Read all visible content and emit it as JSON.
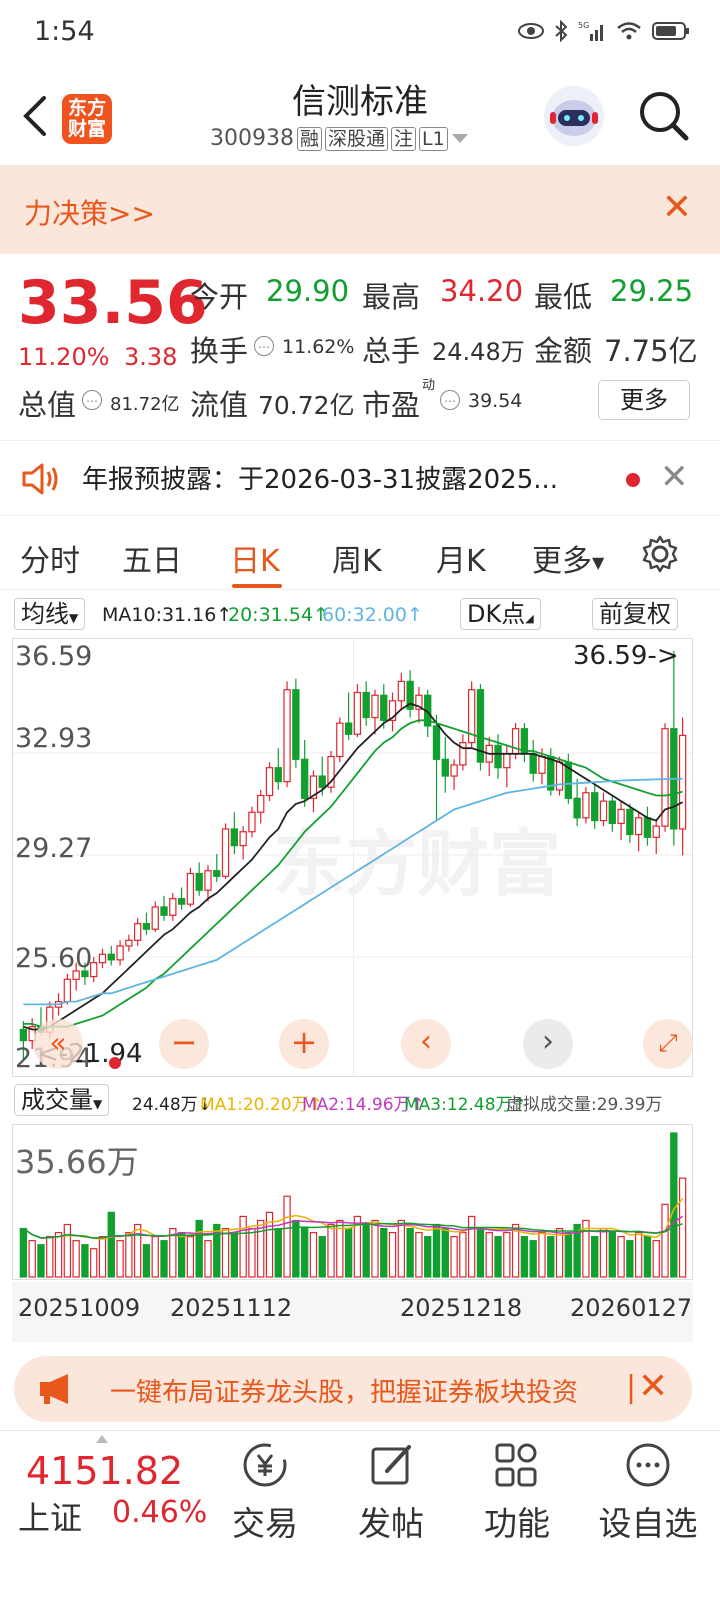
{
  "status": {
    "time": "1:54"
  },
  "header": {
    "logo_top": "东方",
    "logo_bottom": "财富",
    "title": "信测标准",
    "code": "300938",
    "tags": [
      "融",
      "深股通",
      "注",
      "L1"
    ]
  },
  "banner": {
    "text": "力决策>>"
  },
  "quote": {
    "price": "33.56",
    "change_pct": "11.20%",
    "change": "3.38",
    "open_label": "今开",
    "open": "29.90",
    "high_label": "最高",
    "high": "34.20",
    "low_label": "最低",
    "low": "29.25",
    "turnover_label": "换手",
    "turnover": "11.62%",
    "volume_label": "总手",
    "volume": "24.48万",
    "amount_label": "金额",
    "amount": "7.75亿",
    "mcap_label": "总值",
    "mcap": "81.72亿",
    "float_label": "流值",
    "float_cap": "70.72亿",
    "pe_label": "市盈",
    "pe_sup": "动",
    "pe": "39.54",
    "more": "更多"
  },
  "notice": {
    "text": "年报预披露：于2026-03-31披露2025..."
  },
  "tabs": [
    "分时",
    "五日",
    "日K",
    "周K",
    "月K",
    "更多"
  ],
  "ma": {
    "selector": "均线",
    "ma10": "MA10:31.16↑",
    "ma20": "20:31.54↑",
    "ma60": "60:32.00↑",
    "dk": "DK点",
    "adjust": "前复权"
  },
  "kchart": {
    "y_labels": [
      "36.59",
      "32.93",
      "29.27",
      "25.60",
      "21.94"
    ],
    "max_marker": "36.59->",
    "min_marker": "<-21.94"
  },
  "vol": {
    "selector": "成交量",
    "current": "24.48万↓",
    "ma1": "MA1:20.20万↑",
    "ma2": "MA2:14.96万↑",
    "ma3": "MA3:12.48万↑",
    "virtual": "虚拟成交量:29.39万",
    "max_label": "35.66万"
  },
  "dates": [
    "20251009",
    "20251112",
    "20251218",
    "20260127"
  ],
  "ad": {
    "text": "一键布局证券龙头股，把握证券板块投资"
  },
  "bottom": {
    "index_value": "4151.82",
    "index_name": "上证",
    "index_chg": "0.46%",
    "items": [
      "交易",
      "发帖",
      "功能",
      "设自选"
    ]
  },
  "colors": {
    "up": "#e0262f",
    "down": "#11a030",
    "accent": "#e8571b",
    "ma10": "#222222",
    "ma20": "#11a030",
    "ma60": "#5fb4e0"
  },
  "chart_data": {
    "type": "candlestick",
    "ylim": [
      21.94,
      36.59
    ],
    "candles": [
      [
        23.0,
        23.3,
        21.9,
        22.6
      ],
      [
        22.6,
        23.4,
        22.3,
        23.1
      ],
      [
        23.1,
        23.8,
        22.8,
        22.9
      ],
      [
        22.9,
        24.0,
        22.7,
        23.8
      ],
      [
        23.8,
        24.3,
        23.5,
        24.0
      ],
      [
        24.0,
        25.0,
        23.9,
        24.8
      ],
      [
        24.8,
        25.4,
        24.4,
        25.1
      ],
      [
        25.1,
        25.4,
        24.6,
        24.9
      ],
      [
        24.9,
        25.6,
        24.7,
        25.4
      ],
      [
        25.4,
        25.9,
        25.2,
        25.7
      ],
      [
        25.7,
        26.0,
        25.3,
        25.5
      ],
      [
        25.5,
        26.2,
        25.3,
        26.0
      ],
      [
        26.0,
        26.4,
        25.8,
        26.2
      ],
      [
        26.2,
        27.0,
        26.0,
        26.8
      ],
      [
        26.8,
        27.2,
        26.4,
        26.6
      ],
      [
        26.6,
        27.6,
        26.5,
        27.4
      ],
      [
        27.4,
        27.8,
        26.9,
        27.1
      ],
      [
        27.1,
        27.9,
        26.9,
        27.7
      ],
      [
        27.7,
        28.1,
        27.3,
        27.5
      ],
      [
        27.5,
        28.8,
        27.4,
        28.6
      ],
      [
        28.6,
        29.0,
        27.8,
        28.0
      ],
      [
        28.0,
        28.9,
        27.6,
        28.7
      ],
      [
        28.7,
        29.3,
        28.3,
        28.5
      ],
      [
        28.5,
        30.4,
        28.4,
        30.2
      ],
      [
        30.2,
        30.8,
        29.3,
        29.6
      ],
      [
        29.6,
        30.3,
        29.1,
        30.1
      ],
      [
        30.1,
        31.0,
        29.9,
        30.8
      ],
      [
        30.8,
        31.6,
        30.4,
        31.4
      ],
      [
        31.4,
        32.6,
        31.2,
        32.4
      ],
      [
        32.4,
        33.1,
        31.6,
        31.9
      ],
      [
        31.9,
        35.5,
        31.7,
        35.2
      ],
      [
        35.2,
        35.6,
        32.4,
        32.7
      ],
      [
        32.7,
        33.4,
        31.0,
        31.3
      ],
      [
        31.3,
        32.3,
        30.8,
        32.1
      ],
      [
        32.1,
        32.8,
        31.4,
        31.7
      ],
      [
        31.7,
        33.0,
        31.5,
        32.8
      ],
      [
        32.8,
        34.2,
        32.6,
        34.0
      ],
      [
        34.0,
        35.1,
        33.4,
        33.6
      ],
      [
        33.6,
        35.4,
        33.5,
        35.1
      ],
      [
        35.1,
        35.5,
        33.9,
        34.2
      ],
      [
        34.2,
        35.2,
        33.6,
        35.0
      ],
      [
        35.0,
        35.4,
        33.8,
        34.1
      ],
      [
        34.1,
        35.1,
        33.7,
        34.8
      ],
      [
        34.8,
        35.8,
        34.5,
        35.5
      ],
      [
        35.5,
        35.9,
        34.2,
        34.5
      ],
      [
        34.5,
        35.3,
        34.0,
        35.0
      ],
      [
        35.0,
        35.2,
        33.5,
        33.9
      ],
      [
        33.9,
        34.3,
        30.5,
        32.7
      ],
      [
        32.7,
        33.5,
        31.5,
        32.1
      ],
      [
        32.1,
        32.7,
        31.6,
        32.5
      ],
      [
        32.5,
        33.6,
        32.3,
        33.3
      ],
      [
        33.3,
        35.5,
        33.1,
        35.2
      ],
      [
        35.2,
        35.4,
        32.3,
        32.6
      ],
      [
        32.6,
        33.5,
        32.1,
        33.2
      ],
      [
        33.2,
        33.6,
        32.0,
        32.4
      ],
      [
        32.4,
        33.2,
        31.7,
        32.9
      ],
      [
        32.9,
        34.0,
        32.7,
        33.8
      ],
      [
        33.8,
        34.0,
        32.6,
        32.9
      ],
      [
        32.9,
        33.4,
        31.9,
        32.2
      ],
      [
        32.2,
        33.1,
        31.8,
        32.8
      ],
      [
        32.8,
        33.1,
        31.4,
        31.6
      ],
      [
        31.6,
        32.8,
        31.4,
        32.6
      ],
      [
        32.6,
        32.9,
        31.1,
        31.3
      ],
      [
        31.3,
        32.0,
        30.3,
        30.6
      ],
      [
        30.6,
        31.7,
        30.4,
        31.5
      ],
      [
        31.5,
        31.8,
        30.2,
        30.5
      ],
      [
        30.5,
        31.5,
        30.3,
        31.2
      ],
      [
        31.2,
        31.4,
        30.1,
        30.4
      ],
      [
        30.4,
        31.2,
        29.8,
        30.9
      ],
      [
        30.9,
        31.1,
        29.7,
        30.0
      ],
      [
        30.0,
        30.8,
        29.4,
        30.6
      ],
      [
        30.6,
        31.0,
        29.6,
        29.9
      ],
      [
        29.9,
        30.5,
        29.3,
        30.3
      ],
      [
        30.3,
        34.0,
        30.1,
        33.8
      ],
      [
        33.8,
        36.59,
        29.6,
        30.2
      ],
      [
        30.2,
        34.2,
        29.25,
        33.56
      ]
    ],
    "ma10": [
      23.1,
      23.0,
      23.0,
      23.1,
      23.3,
      23.5,
      23.7,
      23.9,
      24.1,
      24.3,
      24.6,
      24.9,
      25.2,
      25.5,
      25.8,
      26.1,
      26.4,
      26.6,
      26.9,
      27.2,
      27.4,
      27.7,
      27.9,
      28.2,
      28.5,
      28.8,
      29.1,
      29.5,
      29.9,
      30.2,
      30.8,
      31.1,
      31.2,
      31.4,
      31.6,
      31.9,
      32.3,
      32.7,
      33.1,
      33.4,
      33.7,
      34.0,
      34.2,
      34.5,
      34.7,
      34.6,
      34.4,
      34.0,
      33.6,
      33.3,
      33.1,
      33.1,
      33.0,
      32.9,
      32.9,
      32.9,
      32.9,
      32.9,
      32.9,
      32.8,
      32.7,
      32.6,
      32.4,
      32.2,
      32.0,
      31.8,
      31.6,
      31.4,
      31.2,
      31.0,
      30.8,
      30.6,
      30.5,
      30.9,
      31.0,
      31.16
    ],
    "ma20": [
      23.2,
      23.2,
      23.1,
      23.1,
      23.1,
      23.1,
      23.2,
      23.3,
      23.4,
      23.5,
      23.7,
      23.9,
      24.1,
      24.3,
      24.5,
      24.8,
      25.0,
      25.3,
      25.6,
      25.9,
      26.2,
      26.5,
      26.8,
      27.1,
      27.4,
      27.7,
      28.0,
      28.3,
      28.6,
      28.9,
      29.3,
      29.7,
      30.1,
      30.4,
      30.7,
      31.0,
      31.4,
      31.8,
      32.2,
      32.6,
      33.0,
      33.3,
      33.5,
      33.8,
      34.0,
      34.1,
      34.1,
      34.0,
      33.9,
      33.8,
      33.7,
      33.6,
      33.5,
      33.4,
      33.3,
      33.2,
      33.1,
      33.0,
      33.0,
      32.9,
      32.8,
      32.7,
      32.6,
      32.5,
      32.4,
      32.2,
      32.0,
      31.9,
      31.8,
      31.7,
      31.6,
      31.5,
      31.4,
      31.4,
      31.45,
      31.54
    ],
    "ma60": [
      23.9,
      23.9,
      23.9,
      23.9,
      23.9,
      24.0,
      24.0,
      24.1,
      24.2,
      24.3,
      24.3,
      24.4,
      24.5,
      24.6,
      24.7,
      24.8,
      24.9,
      25.0,
      25.1,
      25.2,
      25.3,
      25.4,
      25.5,
      25.7,
      25.9,
      26.1,
      26.3,
      26.5,
      26.7,
      26.9,
      27.1,
      27.3,
      27.5,
      27.7,
      27.9,
      28.1,
      28.3,
      28.5,
      28.7,
      28.9,
      29.1,
      29.3,
      29.5,
      29.7,
      29.9,
      30.1,
      30.3,
      30.5,
      30.7,
      30.9,
      31.0,
      31.1,
      31.2,
      31.3,
      31.4,
      31.5,
      31.55,
      31.6,
      31.65,
      31.7,
      31.75,
      31.8,
      31.82,
      31.84,
      31.86,
      31.88,
      31.9,
      31.92,
      31.94,
      31.95,
      31.96,
      31.97,
      31.98,
      31.99,
      32.0,
      32.0
    ],
    "volume_max": 35.66,
    "volume": [
      12,
      9,
      8,
      10,
      11,
      13,
      9,
      8,
      7,
      10,
      16,
      9,
      11,
      13,
      8,
      10,
      9,
      12,
      11,
      10,
      14,
      9,
      13,
      12,
      11,
      15,
      12,
      14,
      16,
      12,
      20,
      14,
      12,
      11,
      10,
      13,
      14,
      12,
      15,
      13,
      14,
      12,
      11,
      14,
      12,
      11,
      10,
      13,
      12,
      10,
      11,
      15,
      12,
      11,
      10,
      11,
      13,
      10,
      9,
      11,
      10,
      12,
      11,
      13,
      14,
      10,
      12,
      11,
      10,
      9,
      11,
      10,
      9,
      18,
      35.66,
      24.48
    ]
  }
}
